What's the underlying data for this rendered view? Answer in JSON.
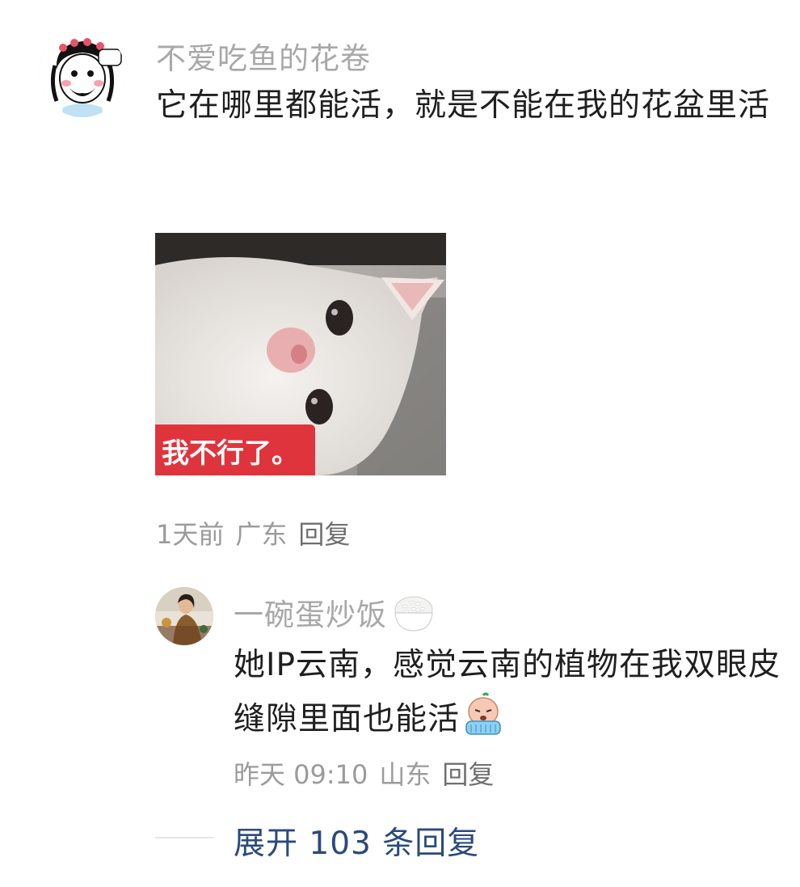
{
  "comment": {
    "username": "不爱吃鱼的花卷",
    "text": "它在哪里都能活，就是不能在我的花盆里活",
    "image": {
      "caption": "我不行了。",
      "caption_bg": "#e0343d"
    },
    "meta": {
      "time": "1天前",
      "location": "广东",
      "reply_label": "回复"
    }
  },
  "reply": {
    "username": "一碗蛋炒饭",
    "username_icon": "rice-bowl-icon",
    "text": "她IP云南，感觉云南的植物在我双眼皮缝隙里面也能活",
    "text_icon": "crying-emoji-icon",
    "meta": {
      "time": "昨天 09:10",
      "location": "山东",
      "reply_label": "回复"
    }
  },
  "expand": {
    "label": "展开 103 条回复",
    "color": "#2b4a7c"
  }
}
